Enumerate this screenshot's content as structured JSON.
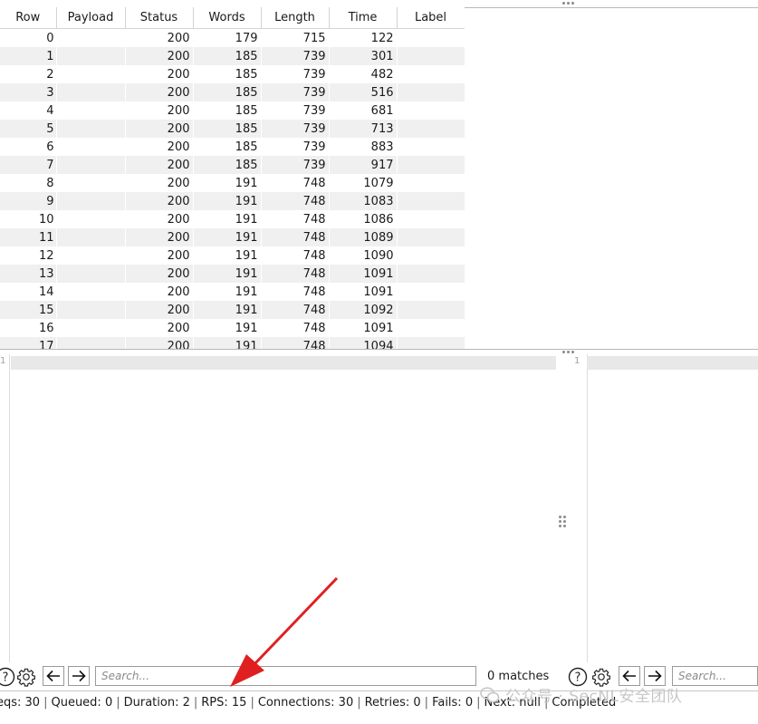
{
  "table": {
    "columns": [
      "Row",
      "Payload",
      "Status",
      "Words",
      "Length",
      "Time",
      "Label"
    ],
    "rows": [
      [
        "0",
        "",
        "200",
        "179",
        "715",
        "122",
        ""
      ],
      [
        "1",
        "",
        "200",
        "185",
        "739",
        "301",
        ""
      ],
      [
        "2",
        "",
        "200",
        "185",
        "739",
        "482",
        ""
      ],
      [
        "3",
        "",
        "200",
        "185",
        "739",
        "516",
        ""
      ],
      [
        "4",
        "",
        "200",
        "185",
        "739",
        "681",
        ""
      ],
      [
        "5",
        "",
        "200",
        "185",
        "739",
        "713",
        ""
      ],
      [
        "6",
        "",
        "200",
        "185",
        "739",
        "883",
        ""
      ],
      [
        "7",
        "",
        "200",
        "185",
        "739",
        "917",
        ""
      ],
      [
        "8",
        "",
        "200",
        "191",
        "748",
        "1079",
        ""
      ],
      [
        "9",
        "",
        "200",
        "191",
        "748",
        "1083",
        ""
      ],
      [
        "10",
        "",
        "200",
        "191",
        "748",
        "1086",
        ""
      ],
      [
        "11",
        "",
        "200",
        "191",
        "748",
        "1089",
        ""
      ],
      [
        "12",
        "",
        "200",
        "191",
        "748",
        "1090",
        ""
      ],
      [
        "13",
        "",
        "200",
        "191",
        "748",
        "1091",
        ""
      ],
      [
        "14",
        "",
        "200",
        "191",
        "748",
        "1091",
        ""
      ],
      [
        "15",
        "",
        "200",
        "191",
        "748",
        "1092",
        ""
      ],
      [
        "16",
        "",
        "200",
        "191",
        "748",
        "1091",
        ""
      ],
      [
        "17",
        "",
        "200",
        "191",
        "748",
        "1094",
        ""
      ]
    ]
  },
  "request_editor": {
    "line_number": "1"
  },
  "response_editor": {
    "line_number": "1"
  },
  "search_left": {
    "placeholder": "Search...",
    "matches": "0 matches"
  },
  "search_right": {
    "placeholder": "Search..."
  },
  "status": {
    "items": [
      "eqs: 30",
      "Queued: 0",
      "Duration: 2",
      "RPS: 15",
      "Connections: 30",
      "Retries: 0",
      "Fails: 0",
      "Next: null",
      "Completed"
    ]
  },
  "watermark": {
    "text": "公众号 · SecNL安全团队"
  },
  "icons": {
    "help": "help-icon",
    "settings": "gear-icon",
    "back": "arrow-left-icon",
    "forward": "arrow-right-icon",
    "annotation": "red-arrow"
  },
  "colors": {
    "annotation": "#e02020",
    "row_alt": "#f0f0f0"
  }
}
